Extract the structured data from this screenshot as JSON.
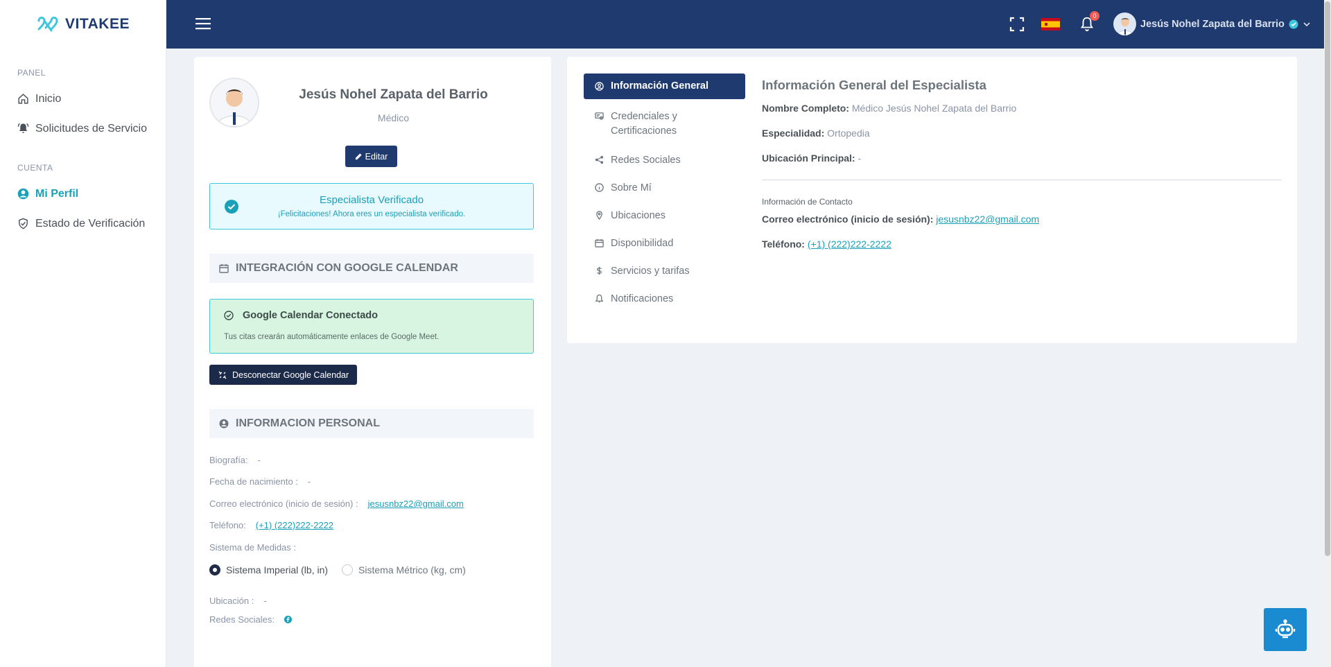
{
  "brand": {
    "name": "VITAKEE",
    "accent": "#3ec6dc",
    "navy": "#1f3a6e"
  },
  "sidebar": {
    "sections": [
      {
        "title": "PANEL",
        "items": [
          {
            "label": "Inicio",
            "icon": "home-icon"
          },
          {
            "label": "Solicitudes de Servicio",
            "icon": "bell-ring-icon"
          }
        ]
      },
      {
        "title": "CUENTA",
        "items": [
          {
            "label": "Mi Perfil",
            "icon": "user-circle-icon",
            "active": true
          },
          {
            "label": "Estado de Verificación",
            "icon": "shield-check-icon"
          }
        ]
      }
    ]
  },
  "topbar": {
    "notification_count": "0",
    "user_name": "Jesús Nohel Zapata del Barrio",
    "language_flag": "es"
  },
  "profile": {
    "name": "Jesús Nohel Zapata del Barrio",
    "role": "Médico",
    "edit_label": "Editar",
    "verified_title": "Especialista Verificado",
    "verified_sub": "¡Felicitaciones! Ahora eres un especialista verificado."
  },
  "gcal": {
    "section_title": "INTEGRACIÓN CON GOOGLE CALENDAR",
    "status_title": "Google Calendar Conectado",
    "status_sub": "Tus citas crearán automáticamente enlaces de Google Meet.",
    "disconnect_label": "Desconectar Google Calendar"
  },
  "personal": {
    "section_title": "INFORMACION PERSONAL",
    "bio_label": "Biografía:",
    "bio_value": "-",
    "birth_label": "Fecha de nacimiento :",
    "birth_value": "-",
    "email_label": "Correo electrónico (inicio de sesión) :",
    "email_value": "jesusnbz22@gmail.com",
    "phone_label": "Teléfono:",
    "phone_value": "(+1) (222)222-2222",
    "measure_label": "Sistema de Medidas :",
    "imperial_label": "Sistema Imperial (lb, in)",
    "metric_label": "Sistema Métrico (kg, cm)",
    "location_label": "Ubicación :",
    "location_value": "-",
    "social_label": "Redes Sociales:"
  },
  "tabs": [
    {
      "label": "Información General",
      "icon": "user-circle-icon",
      "active": true
    },
    {
      "label": "Credenciales y Certificaciones",
      "icon": "certificate-icon"
    },
    {
      "label": "Redes Sociales",
      "icon": "share-icon"
    },
    {
      "label": "Sobre Mí",
      "icon": "info-icon"
    },
    {
      "label": "Ubicaciones",
      "icon": "map-pin-icon"
    },
    {
      "label": "Disponibilidad",
      "icon": "calendar-icon"
    },
    {
      "label": "Servicios y tarifas",
      "icon": "dollar-icon"
    },
    {
      "label": "Notificaciones",
      "icon": "bell-icon"
    }
  ],
  "general": {
    "title": "Información General del Especialista",
    "fullname_label": "Nombre Completo:",
    "fullname_value": "Médico Jesús Nohel Zapata del Barrio",
    "specialty_label": "Especialidad:",
    "specialty_value": "Ortopedia",
    "location_label": "Ubicación Principal:",
    "location_value": "-",
    "contact_head": "Información de Contacto",
    "email_label": "Correo electrónico (inicio de sesión):",
    "email_value": "jesusnbz22@gmail.com",
    "phone_label": "Teléfono:",
    "phone_value": "(+1) (222)222-2222"
  }
}
